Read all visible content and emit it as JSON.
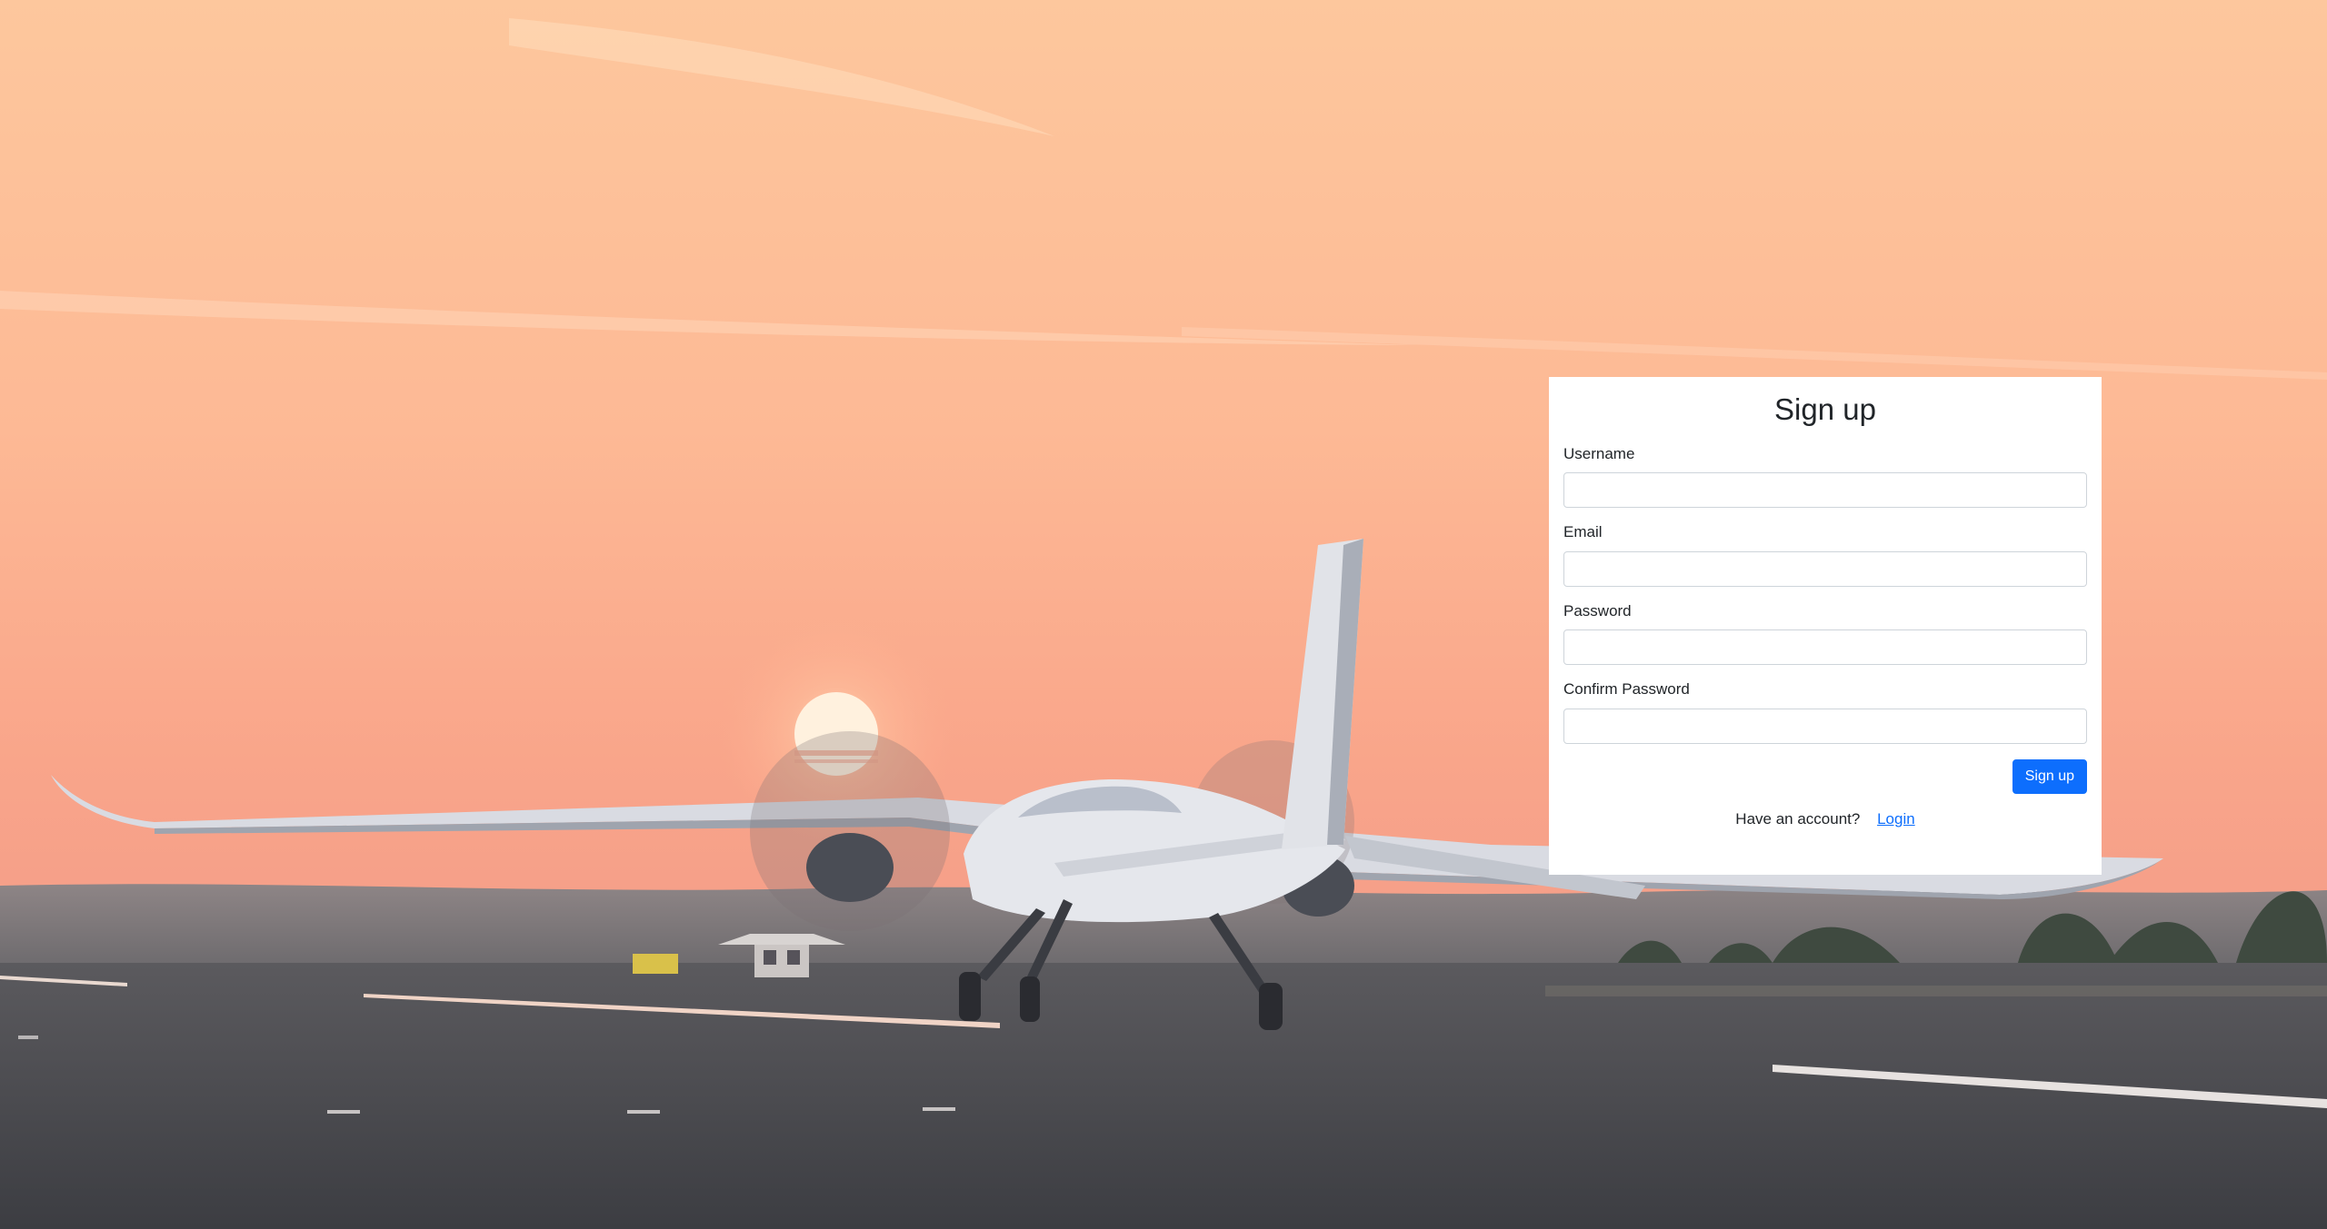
{
  "form": {
    "title": "Sign up",
    "fields": [
      {
        "label": "Username",
        "value": "",
        "type": "text"
      },
      {
        "label": "Email",
        "value": "",
        "type": "email"
      },
      {
        "label": "Password",
        "value": "",
        "type": "password"
      },
      {
        "label": "Confirm Password",
        "value": "",
        "type": "password"
      }
    ],
    "submit_label": "Sign up",
    "account_prompt": "Have an account?",
    "login_link": "Login"
  },
  "colors": {
    "primary": "#0d6efd",
    "card_background": "#ffffff",
    "sky_top": "#fcc9a0",
    "sky_horizon": "#f8a488",
    "runway": "#45474d"
  },
  "background": {
    "subject": "aircraft-on-runway-at-sunset"
  }
}
